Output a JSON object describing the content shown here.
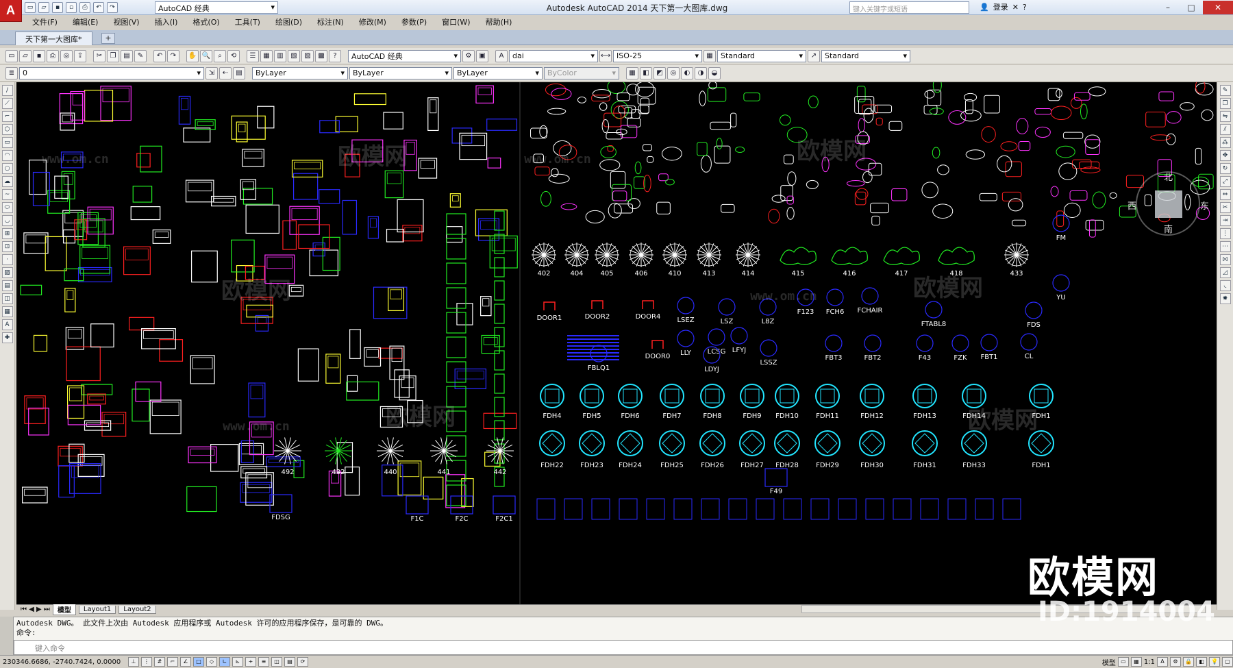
{
  "app": {
    "logo": "A",
    "title": "Autodesk AutoCAD 2014    天下第一大图库.dwg",
    "workspace": "AutoCAD 经典",
    "search_placeholder": "键入关键字或短语",
    "login": "登录"
  },
  "window_controls": [
    "–",
    "□",
    "✕"
  ],
  "menus": [
    "文件(F)",
    "编辑(E)",
    "视图(V)",
    "插入(I)",
    "格式(O)",
    "工具(T)",
    "绘图(D)",
    "标注(N)",
    "修改(M)",
    "参数(P)",
    "窗口(W)",
    "帮助(H)"
  ],
  "document_tab": "天下第一大图库*",
  "toolbar1": {
    "workspace_dd": "AutoCAD 经典",
    "text_style_dd": "dai",
    "dim_style_dd": "ISO-25",
    "table_style_dd": "Standard",
    "mleader_style_dd": "Standard"
  },
  "toolbar2": {
    "layer_dd": "0",
    "color_dd": "ByLayer",
    "linetype_dd": "ByLayer",
    "lineweight_dd": "ByLayer",
    "plotstyle_dd": "ByColor"
  },
  "canvas_labels": {
    "trees": [
      "402",
      "404",
      "405",
      "406",
      "410",
      "413",
      "414",
      "415",
      "416",
      "417",
      "418",
      "433"
    ],
    "doors": [
      "DOOR1",
      "DOOR2",
      "DOOR4",
      "DOOR0"
    ],
    "furniture": [
      "LSEZ",
      "LSZ",
      "L8Z",
      "F123",
      "FCH6",
      "FCHAIR",
      "FTABL8",
      "FDS",
      "FBLQ1",
      "LLY",
      "LCSG",
      "LFYJ",
      "LSSZ",
      "LDYJ",
      "FBT3",
      "FBT2",
      "F43",
      "FZK",
      "FBT1",
      "CL",
      "YU",
      "FM"
    ],
    "fdh_row1": [
      "FDH4",
      "FDH5",
      "FDH6",
      "FDH7",
      "FDH8",
      "FDH9",
      "FDH10",
      "FDH11",
      "FDH12",
      "FDH13",
      "FDH14",
      "FDH1"
    ],
    "fdh_row2": [
      "FDH22",
      "FDH23",
      "FDH24",
      "FDH25",
      "FDH26",
      "FDH27",
      "FDH28",
      "FDH29",
      "FDH30",
      "FDH31",
      "FDH33",
      "FDH1"
    ],
    "plants": [
      "492",
      "432",
      "440",
      "441",
      "442"
    ],
    "bottom": [
      "FDSG",
      "F1C",
      "F2C",
      "F2C1",
      "F49"
    ]
  },
  "compass": {
    "north": "北",
    "east": "东",
    "south": "南",
    "west": "西"
  },
  "watermarks": {
    "brand": "欧模网",
    "url": "www.om.cn",
    "id": "ID:1914004"
  },
  "layout_tabs": [
    "模型",
    "Layout1",
    "Layout2"
  ],
  "command": {
    "history_line1": "Autodesk DWG。 此文件上次由 Autodesk 应用程序或 Autodesk 许可的应用程序保存，是可靠的 DWG。",
    "history_line2": "命令:",
    "input_placeholder": "键入命令"
  },
  "status": {
    "coordinates": "230346.6686, -2740.7424, 0.0000",
    "model_label": "模型",
    "scale": "1:1"
  },
  "colors": {
    "canvas": "#000000",
    "red": "#ff2020",
    "blue": "#2a2aff",
    "green": "#22ee22",
    "yellow": "#ffff33",
    "magenta": "#ff33ff",
    "cyan": "#22e5ff",
    "white": "#ffffff"
  }
}
